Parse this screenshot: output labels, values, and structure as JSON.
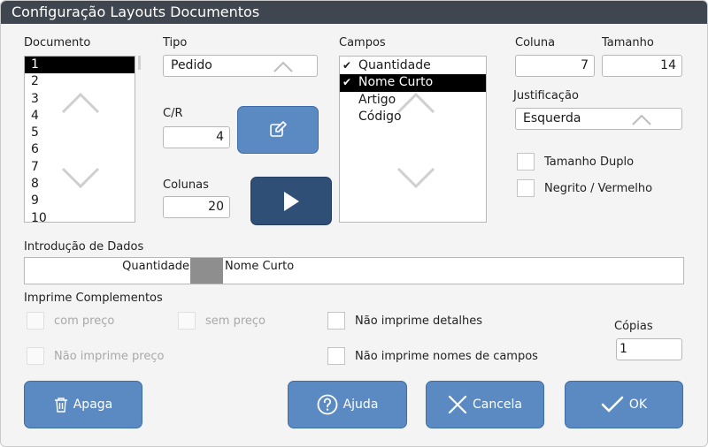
{
  "window": {
    "title": "Configuração Layouts Documentos"
  },
  "documento": {
    "label": "Documento",
    "items": [
      "1",
      "2",
      "3",
      "4",
      "5",
      "6",
      "7",
      "8",
      "9",
      "10"
    ],
    "selected": "1"
  },
  "tipo": {
    "label": "Tipo",
    "value": "Pedido"
  },
  "cr": {
    "label": "C/R",
    "value": "4"
  },
  "colunas": {
    "label": "Colunas",
    "value": "20"
  },
  "campos": {
    "label": "Campos",
    "items": [
      {
        "label": "Quantidade",
        "checked": true
      },
      {
        "label": "Nome Curto",
        "checked": true
      },
      {
        "label": "Artigo",
        "checked": false
      },
      {
        "label": "Código",
        "checked": false
      }
    ],
    "check_glyph": "✔"
  },
  "coluna": {
    "label": "Coluna",
    "value": "7"
  },
  "tamanho": {
    "label": "Tamanho",
    "value": "14"
  },
  "justificacao": {
    "label": "Justificação",
    "value": "Esquerda"
  },
  "tamanho_duplo": {
    "label": "Tamanho Duplo",
    "checked": false
  },
  "negrito": {
    "label": "Negrito / Vermelho",
    "checked": false
  },
  "introducao": {
    "label": "Introdução de Dados",
    "left_field": "Quantidade",
    "right_field": "Nome Curto"
  },
  "complementos": {
    "label": "Imprime Complementos",
    "com_preco": "com preço",
    "sem_preco": "sem preço",
    "nao_imprime_preco": "Não imprime preço",
    "nao_imprime_detalhes": "Não imprime detalhes",
    "nao_imprime_nomes": "Não imprime nomes de campos"
  },
  "copias": {
    "label": "Cópias",
    "value": "1"
  },
  "buttons": {
    "apaga": "Apaga",
    "ajuda": "Ajuda",
    "cancela": "Cancela",
    "ok": "OK"
  },
  "colors": {
    "titlebar": "#3f4650",
    "button": "#5b8ac3",
    "button_dark": "#2f4f77",
    "selection": "#000000"
  },
  "icons": {
    "edit": "edit-icon",
    "play": "play-icon",
    "trash": "trash-icon",
    "help": "help-icon",
    "close": "close-icon",
    "check": "check-icon",
    "chevron_up": "chevron-up-icon",
    "chevron_down": "chevron-down-icon"
  }
}
